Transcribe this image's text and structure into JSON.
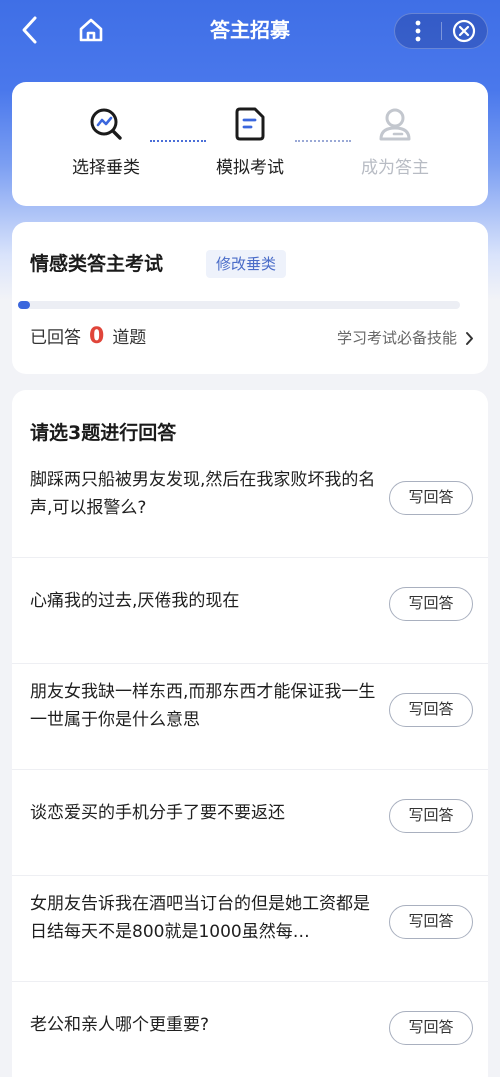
{
  "header": {
    "title": "答主招募",
    "back_icon": "chevron-left-icon",
    "home_icon": "home-icon",
    "more_icon": "more-vertical-icon",
    "close_icon": "close-circle-icon"
  },
  "steps": [
    {
      "label": "选择垂类",
      "icon": "search-chart-icon",
      "state": "done"
    },
    {
      "label": "模拟考试",
      "icon": "document-icon",
      "state": "current"
    },
    {
      "label": "成为答主",
      "icon": "user-icon",
      "state": "pending"
    }
  ],
  "exam": {
    "title": "情感类答主考试",
    "modify_label": "修改垂类",
    "answered_prefix": "已回答",
    "answered_count": "0",
    "answered_suffix": "道题",
    "skills_link": "学习考试必备技能",
    "progress_fraction": 0.02
  },
  "questions": {
    "heading": "请选3题进行回答",
    "button_label": "写回答",
    "items": [
      {
        "text": "脚踩两只船被男友发现,然后在我家败坏我的名声,可以报警么?"
      },
      {
        "text": "心痛我的过去,厌倦我的现在"
      },
      {
        "text": "朋友女我缺一样东西,而那东西才能保证我一生一世属于你是什么意思"
      },
      {
        "text": "谈恋爱买的手机分手了要不要返还"
      },
      {
        "text": "女朋友告诉我在酒吧当订台的但是她工资都是日结每天不是800就是1000虽然每…"
      },
      {
        "text": "老公和亲人哪个更重要?"
      }
    ]
  },
  "colors": {
    "accent": "#3b67dd",
    "count": "#e0453a",
    "pending": "#b8bcc4"
  }
}
